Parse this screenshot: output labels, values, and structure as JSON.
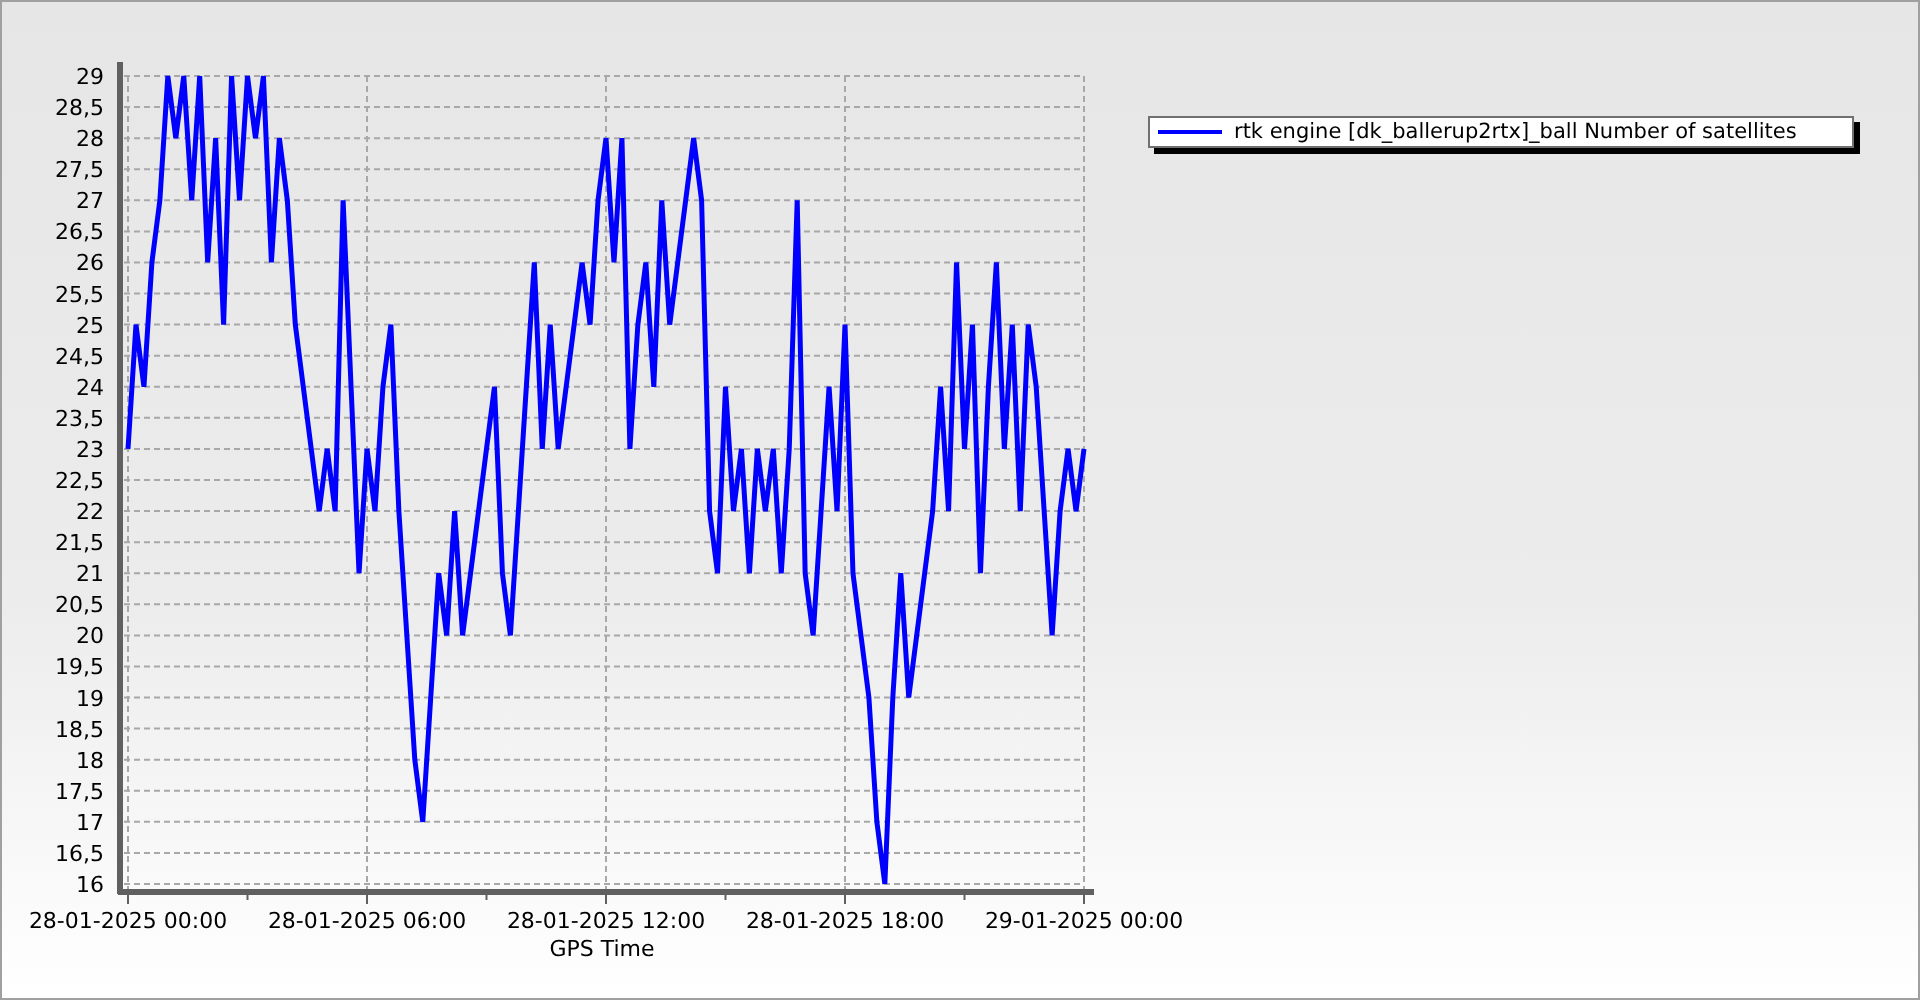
{
  "chart": {
    "chart_data": {
      "type": "line",
      "grid": true,
      "xlabel": "GPS Time",
      "ylim": [
        16,
        29
      ],
      "categories": [
        "28-01-2025 00:00",
        null,
        null,
        null,
        null,
        null,
        null,
        null,
        null,
        null,
        null,
        null,
        null,
        null,
        null,
        null,
        null,
        null,
        null,
        null,
        null,
        null,
        null,
        null,
        null,
        null,
        null,
        null,
        null,
        null,
        "28-01-2025 06:00",
        null,
        null,
        null,
        null,
        null,
        null,
        null,
        null,
        null,
        null,
        null,
        null,
        null,
        null,
        null,
        null,
        null,
        null,
        null,
        null,
        null,
        null,
        null,
        null,
        null,
        null,
        null,
        null,
        null,
        "28-01-2025 12:00",
        null,
        null,
        null,
        null,
        null,
        null,
        null,
        null,
        null,
        null,
        null,
        null,
        null,
        null,
        null,
        null,
        null,
        null,
        null,
        null,
        null,
        null,
        null,
        null,
        null,
        null,
        null,
        null,
        null,
        "28-01-2025 18:00",
        null,
        null,
        null,
        null,
        null,
        null,
        null,
        null,
        null,
        null,
        null,
        null,
        null,
        null,
        null,
        null,
        null,
        null,
        null,
        null,
        null,
        null,
        null,
        null,
        null,
        null,
        null,
        null,
        null,
        "29-01-2025 00:00"
      ],
      "yticks": [
        {
          "value": 16,
          "label": "16"
        },
        {
          "value": 16.5,
          "label": "16,5"
        },
        {
          "value": 17,
          "label": "17"
        },
        {
          "value": 17.5,
          "label": "17,5"
        },
        {
          "value": 18,
          "label": "18"
        },
        {
          "value": 18.5,
          "label": "18,5"
        },
        {
          "value": 19,
          "label": "19"
        },
        {
          "value": 19.5,
          "label": "19,5"
        },
        {
          "value": 20,
          "label": "20"
        },
        {
          "value": 20.5,
          "label": "20,5"
        },
        {
          "value": 21,
          "label": "21"
        },
        {
          "value": 21.5,
          "label": "21,5"
        },
        {
          "value": 22,
          "label": "22"
        },
        {
          "value": 22.5,
          "label": "22,5"
        },
        {
          "value": 23,
          "label": "23"
        },
        {
          "value": 23.5,
          "label": "23,5"
        },
        {
          "value": 24,
          "label": "24"
        },
        {
          "value": 24.5,
          "label": "24,5"
        },
        {
          "value": 25,
          "label": "25"
        },
        {
          "value": 25.5,
          "label": "25,5"
        },
        {
          "value": 26,
          "label": "26"
        },
        {
          "value": 26.5,
          "label": "26,5"
        },
        {
          "value": 27,
          "label": "27"
        },
        {
          "value": 27.5,
          "label": "27,5"
        },
        {
          "value": 28,
          "label": "28"
        },
        {
          "value": 28.5,
          "label": "28,5"
        },
        {
          "value": 29,
          "label": "29"
        }
      ],
      "series": [
        {
          "name": "rtk engine [dk_ballerup2rtx]_ball Number of satellites",
          "color": "#0000ff",
          "values": [
            23,
            25,
            24,
            26,
            27,
            29,
            28,
            29,
            27,
            29,
            26,
            28,
            25,
            29,
            27,
            29,
            28,
            29,
            26,
            28,
            27,
            25,
            24,
            23,
            22,
            23,
            22,
            27,
            24,
            21,
            23,
            22,
            24,
            25,
            22,
            20,
            18,
            17,
            19,
            21,
            20,
            22,
            20,
            21,
            22,
            23,
            24,
            21,
            20,
            22,
            24,
            26,
            23,
            25,
            23,
            24,
            25,
            26,
            25,
            27,
            28,
            26,
            28,
            23,
            25,
            26,
            24,
            27,
            25,
            26,
            27,
            28,
            27,
            22,
            21,
            24,
            22,
            23,
            21,
            23,
            22,
            23,
            21,
            23,
            27,
            21,
            20,
            22,
            24,
            22,
            25,
            21,
            20,
            19,
            17,
            16,
            19,
            21,
            19,
            20,
            21,
            22,
            24,
            22,
            26,
            23,
            25,
            21,
            24,
            26,
            23,
            25,
            22,
            25,
            24,
            22,
            20,
            22,
            23,
            22,
            23
          ]
        }
      ]
    }
  }
}
